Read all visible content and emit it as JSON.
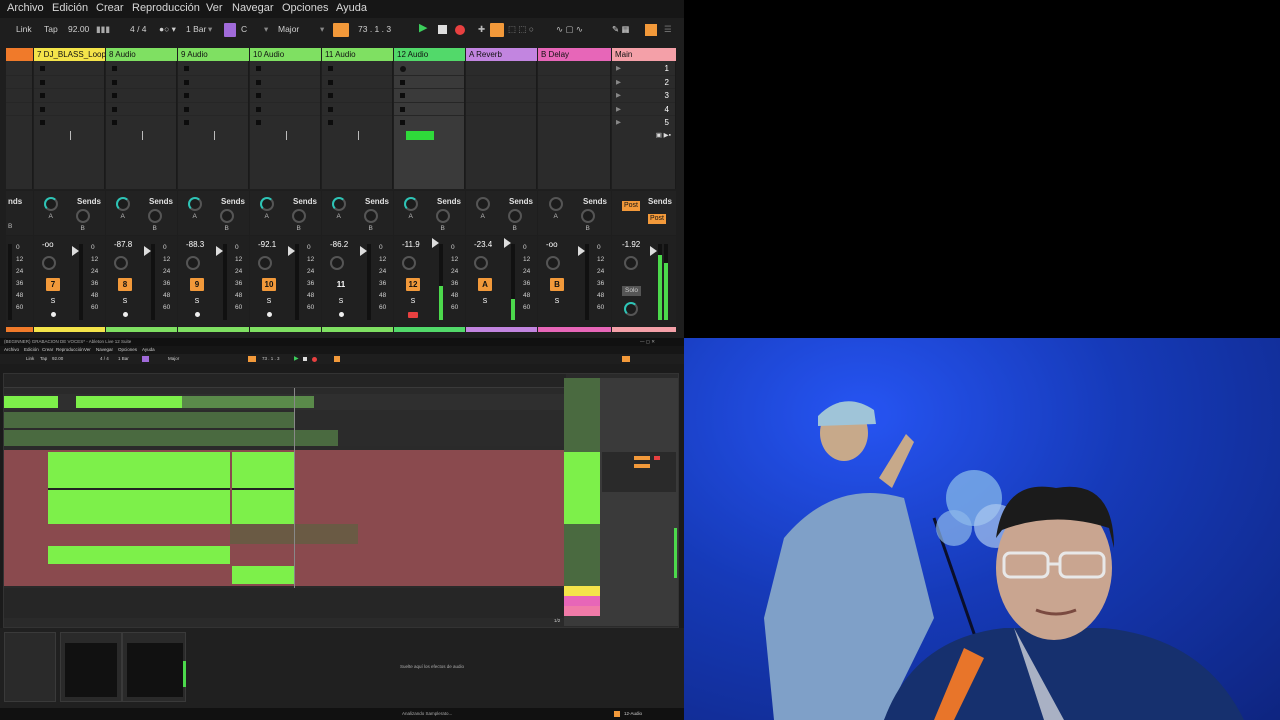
{
  "menu": [
    "Archivo",
    "Edición",
    "Crear",
    "Reproducción",
    "Ver",
    "Navegar",
    "Opciones",
    "Ayuda"
  ],
  "transport": {
    "link": "Link",
    "tap": "Tap",
    "tempo": "92.00",
    "signature": "4 / 4",
    "quantize": "1 Bar",
    "key": "C",
    "scale": "Major",
    "position": "73 .  1 .  3"
  },
  "tracks": [
    {
      "name": "",
      "color": "#f07a2a"
    },
    {
      "name": "7 DJ_BLASS_Loop",
      "color": "#f4e44a",
      "volume": "-oo",
      "number": "7"
    },
    {
      "name": "8 Audio",
      "color": "#7fe062",
      "volume": "-87.8",
      "number": "8"
    },
    {
      "name": "9 Audio",
      "color": "#7fe062",
      "volume": "-88.3",
      "number": "9"
    },
    {
      "name": "10 Audio",
      "color": "#7fe062",
      "volume": "-92.1",
      "number": "10"
    },
    {
      "name": "11 Audio",
      "color": "#7fe062",
      "volume": "-86.2",
      "number": "11"
    },
    {
      "name": "12 Audio",
      "color": "#52d96a",
      "volume": "-11.9",
      "number": "12"
    },
    {
      "name": "A Reverb",
      "color": "#c285e0",
      "volume": "-23.4",
      "number": "A"
    },
    {
      "name": "B Delay",
      "color": "#e766b8",
      "volume": "-oo",
      "number": "B"
    },
    {
      "name": "Main",
      "color": "#f4a0a8",
      "volume": "-1.92"
    }
  ],
  "scenes": [
    "1",
    "2",
    "3",
    "4",
    "5"
  ],
  "sends": {
    "label": "Sends",
    "partial_label": "nds",
    "a": "A",
    "b": "B"
  },
  "db_ticks": [
    "0",
    "12",
    "24",
    "36",
    "48",
    "60"
  ],
  "solo_label": "S",
  "master": {
    "post1": "Post",
    "post2": "Post",
    "solo": "Solo"
  },
  "bottom": {
    "title": "(BEGINNER) GRABACION DE VOCES* - Ableton Live 12 Suite",
    "drop_hint": "Suelte aquí los efectos de audio",
    "status": "Analizando Samplerato...",
    "page": "1/2",
    "track_footer": "12-Audio"
  },
  "colors": {
    "accent": "#f2993a",
    "green_clip": "#7df04a",
    "red_track": "#8a4a4e",
    "purple": "#a06ad9"
  }
}
